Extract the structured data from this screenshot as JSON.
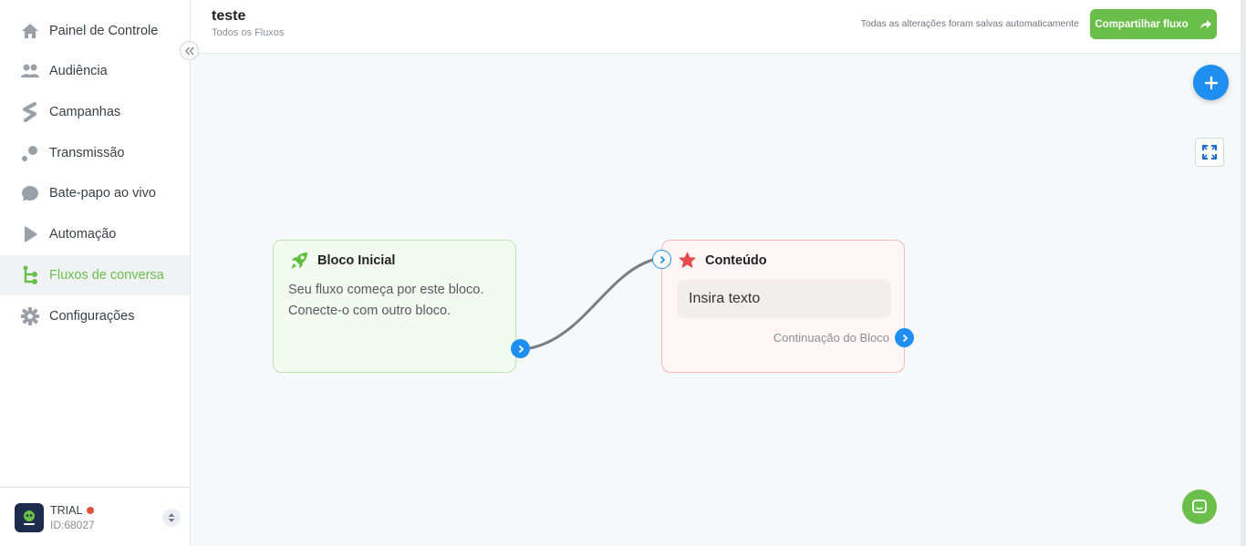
{
  "sidebar": {
    "items": [
      {
        "label": "Painel de Controle",
        "icon": "home-icon"
      },
      {
        "label": "Audiência",
        "icon": "users-icon"
      },
      {
        "label": "Campanhas",
        "icon": "campaign-icon"
      },
      {
        "label": "Transmissão",
        "icon": "broadcast-icon"
      },
      {
        "label": "Bate-papo ao vivo",
        "icon": "chat-bubble-icon"
      },
      {
        "label": "Automação",
        "icon": "play-icon"
      },
      {
        "label": "Fluxos de conversa",
        "icon": "flow-icon",
        "active": true
      },
      {
        "label": "Configurações",
        "icon": "gear-icon"
      }
    ],
    "account": {
      "plan": "TRIAL",
      "id": "ID:68027"
    }
  },
  "header": {
    "title": "teste",
    "breadcrumb": "Todos os Fluxos",
    "save_status": "Todas as alterações foram salvas automaticamente",
    "share_label": "Compartilhar fluxo"
  },
  "canvas": {
    "start_block": {
      "title": "Bloco Inicial",
      "description": "Seu fluxo começa por este bloco. Conecte-o com outro bloco."
    },
    "content_block": {
      "title": "Conteúdo",
      "placeholder": "Insira texto",
      "continuation_label": "Continuação do Bloco"
    }
  },
  "colors": {
    "accent_green": "#6abf4b",
    "accent_blue": "#1f8ef1",
    "danger_red": "#e0533d"
  }
}
